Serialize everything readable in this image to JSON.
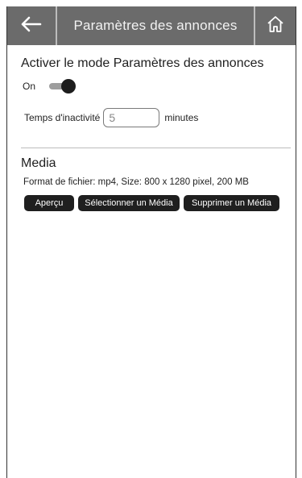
{
  "header": {
    "title": "Paramètres des annonces",
    "back_icon": "arrow-left-icon",
    "home_icon": "home-icon"
  },
  "mode": {
    "title": "Activer le mode Paramètres des annonces",
    "toggle_label": "On",
    "toggle_on": true
  },
  "idle": {
    "label": "Temps d'inactivité",
    "value": "5",
    "unit": "minutes"
  },
  "media": {
    "title": "Media",
    "info": "Format de fichier: mp4, Size: 800 x 1280 pixel, 200 MB",
    "buttons": {
      "preview": "Aperçu",
      "select": "Sélectionner un Média",
      "delete": "Supprimer un Média"
    }
  },
  "colors": {
    "header_bg": "#6b6b6b",
    "button_bg": "#1f1f1f",
    "toggle_knob": "#1d1d1d"
  }
}
